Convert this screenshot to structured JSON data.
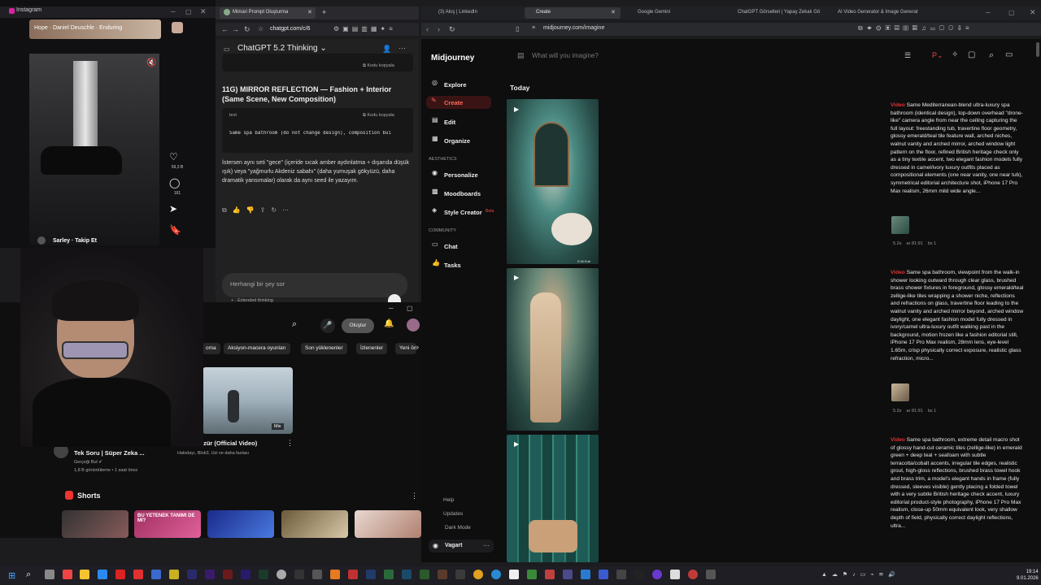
{
  "instagram": {
    "window_title": "Instagram",
    "music_label": "Hope · Daniel Deuschle · Enduring",
    "likes": "59,3 B",
    "comments": "161",
    "author": "Sarley",
    "follow": "Takip Et"
  },
  "chatgpt": {
    "tab_label": "Mimari Prompt Oluşturma",
    "url": "chatgpt.com/c/6",
    "model": "ChatGPT 5.2 Thinking",
    "copy_label": "Kodu kopyala",
    "section_heading": "11G) MIRROR REFLECTION — Fashion + Interior (Same Scene, New Composition)",
    "code_lang": "text",
    "code_line": "Same spa bathroom (do not change design), composition bui",
    "message": "İstersen aynı seti \"gece\" (içeride sıcak amber aydınlatma + dışarıda düşük ışık) veya \"yağmurlu Akdeniz sabahı\" (daha yumuşak gökyüzü, daha dramatik yansımalar) olarak da aynı seed ile yazayım.",
    "input_placeholder": "Herhangi bir şey sor",
    "mode_label": "Extended thinking"
  },
  "youtube": {
    "create_label": "Oluştur",
    "chips": [
      "oma",
      "Aksiyon-macera oyunları",
      "Son yüklenenler",
      "İzlenenler",
      "Yeni öne"
    ],
    "video_title": "odayı - Özür (Official Video)",
    "video_channels": "Halodayı, Blok3, Uzi ve daha fazlası",
    "mix_label": "Mix",
    "left_title": "Tek Soru | Süper Zeka ...",
    "left_channel": "Gerçeği Bul",
    "left_meta": "1,8 B görüntüleme • 1 saat önce",
    "shorts_label": "Shorts",
    "short_text": "BU YETENEK TANIMI DE MI?"
  },
  "midjourney": {
    "tabs": [
      "(3) Akış | LinkedIn",
      "Create",
      "Google Gemini",
      "ChatGPT Görselleri | Yapay Zekalı Gö",
      "AI Video Generator & Image Generat"
    ],
    "url": "midjourney.com/imagine",
    "logo": "Midjourney",
    "search_placeholder": "What will you imagine?",
    "nav": [
      "Explore",
      "Create",
      "Edit",
      "Organize"
    ],
    "aesthetics_label": "AESTHETICS",
    "aesthetics_items": [
      "Personalize",
      "Moodboards",
      "Style Creator"
    ],
    "beta_label": "Beta",
    "community_label": "COMMUNITY",
    "community_items": [
      "Chat",
      "Tasks"
    ],
    "bottom_items": [
      "Help",
      "Updates",
      "Dark Mode"
    ],
    "user": "Vagart",
    "today": "Today",
    "duration": "0:16 Kuh",
    "video_label": "Video",
    "prompts": [
      "Same Mediterranean-blend ultra-luxury spa bathroom (identical design), top-down overhead \"drone-like\" camera angle from near the ceiling capturing the full layout: freestanding tub, travertine floor geometry, glossy emerald/teal tile feature wall, arched niches, walnut vanity and arched mirror, arched window light pattern on the floor, refined British heritage check only as a tiny textile accent, two elegant fashion models fully dressed in camel/ivory luxury outfits placed as compositional elements (one near vanity, one near tub), symmetrical editorial architecture shot, iPhone 17 Pro Max realism, 26mm mild wide angle...",
      "Same spa bathroom, viewpoint from the walk-in shower looking outward through clear glass, brushed brass shower fixtures in foreground, glossy emerald/teal zellige-like tiles wrapping a shower niche, reflections and refractions on glass, travertine floor leading to the walnut vanity and arched mirror beyond, arched window daylight, one elegant fashion model fully dressed in ivory/camel ultra-luxury outfit walking past in the background, motion frozen like a fashion editorial still, iPhone 17 Pro Max realism, 28mm lens, eye-level 1.65m, crisp physically correct exposure, realistic glass refraction, micro...",
      "Same spa bathroom, extreme detail macro shot of glossy hand-cut ceramic tiles (zellige-like) in emerald green + deep teal + seafoam with subtle terracotta/cobalt accents, irregular tile edges, realistic grout, high-gloss reflections, brushed brass towel hook and brass trim, a model's elegant hands in frame (fully dressed, sleeves visible) gently placing a folded towel with a very subtle British heritage check accent, luxury editorial product-style photography, iPhone 17 Pro Max realism, close-up 50mm equivalent look, very shallow depth of field, physically correct daylight reflections, ultra..."
    ],
    "meta": [
      "5.2s",
      "ar 81:91",
      "bs 1"
    ]
  },
  "taskbar": {
    "time": "19:14",
    "date": "9.01.2026"
  }
}
